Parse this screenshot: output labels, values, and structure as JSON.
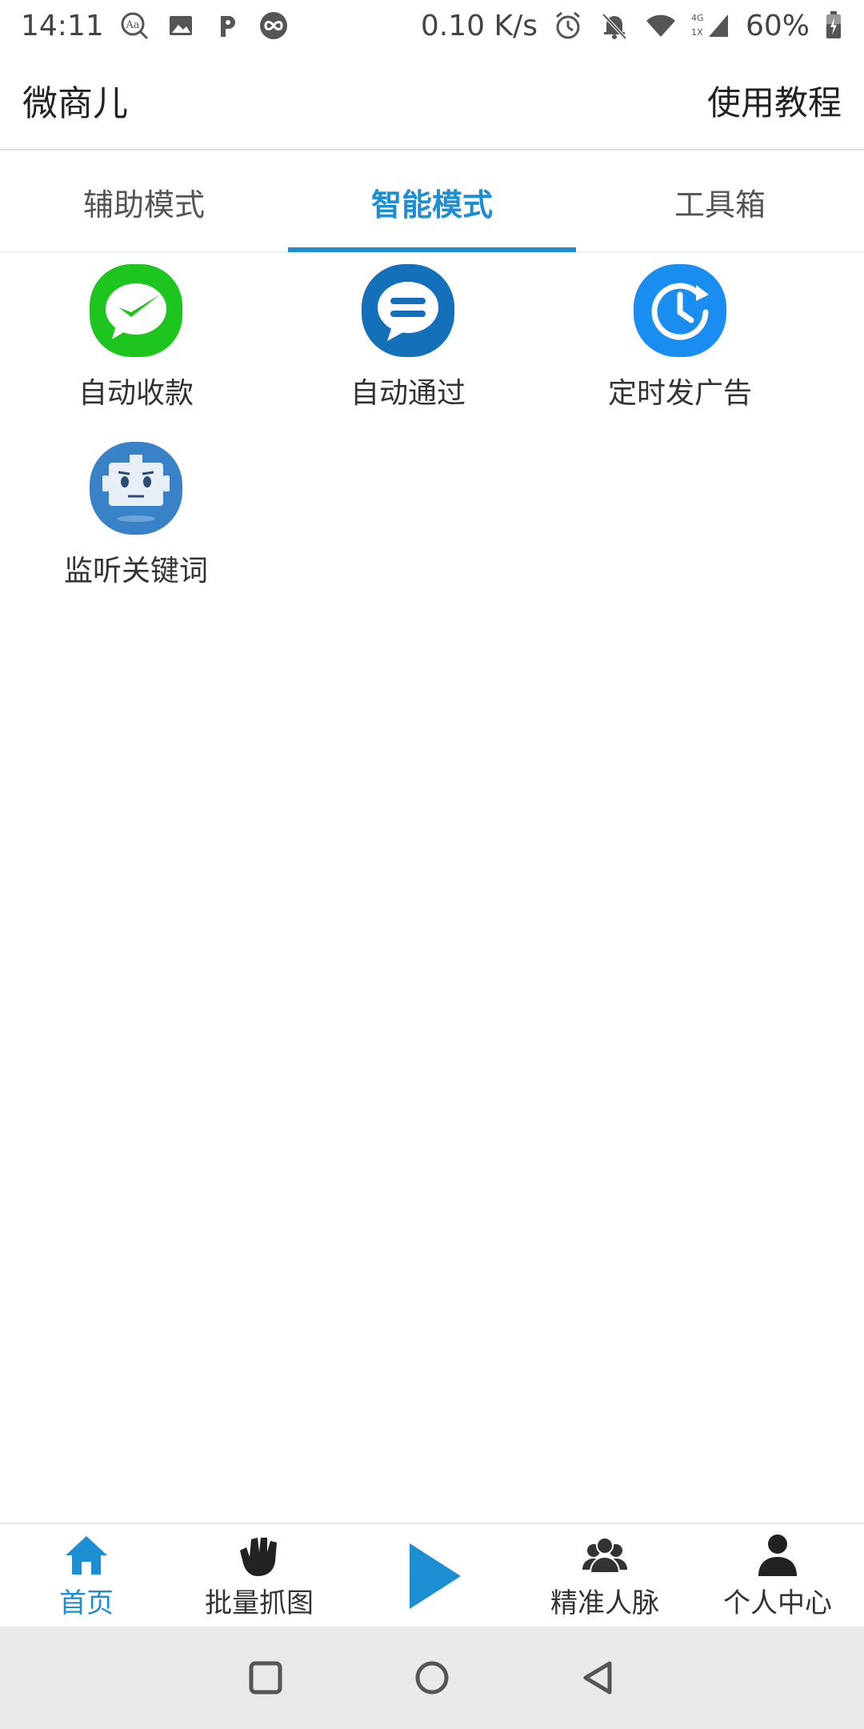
{
  "status_bar": {
    "time": "14:11",
    "net_speed": "0.10 K/s",
    "battery": "60%",
    "network": "4G",
    "sim": "1X",
    "icons": [
      "font-icon",
      "gallery-icon",
      "p-icon",
      "infinity-icon",
      "alarm-icon",
      "bell-off-icon",
      "wifi-icon",
      "signal-icon",
      "battery-icon"
    ]
  },
  "app_bar": {
    "title": "微商儿",
    "action": "使用教程"
  },
  "tabs": [
    {
      "label": "辅助模式",
      "active": false
    },
    {
      "label": "智能模式",
      "active": true
    },
    {
      "label": "工具箱",
      "active": false
    }
  ],
  "features": [
    {
      "label": "自动收款",
      "icon": "wechat-pay-icon"
    },
    {
      "label": "自动通过",
      "icon": "chat-bubble-icon"
    },
    {
      "label": "定时发广告",
      "icon": "clock-icon"
    },
    {
      "label": "监听关键词",
      "icon": "robot-icon"
    }
  ],
  "bottom_nav": [
    {
      "label": "首页",
      "icon": "home-icon",
      "active": true
    },
    {
      "label": "批量抓图",
      "icon": "hand-icon",
      "active": false
    },
    {
      "label": "",
      "icon": "play-icon",
      "active": false
    },
    {
      "label": "精准人脉",
      "icon": "group-icon",
      "active": false
    },
    {
      "label": "个人中心",
      "icon": "user-icon",
      "active": false
    }
  ],
  "colors": {
    "accent": "#1e8ed2",
    "wechat_green": "#1ec51e",
    "chat_blue": "#1470b8",
    "clock_blue": "#1a8ef0",
    "robot_blue": "#3a82c8"
  }
}
